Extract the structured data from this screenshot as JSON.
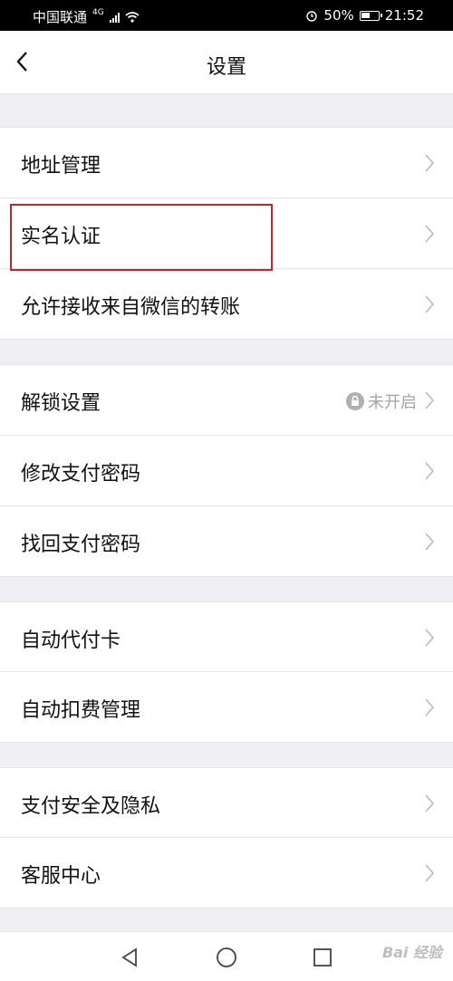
{
  "status_bar": {
    "carrier": "中国联通",
    "network": "4G",
    "battery": "50%",
    "time": "21:52"
  },
  "nav": {
    "title": "设置"
  },
  "sections": [
    {
      "items": [
        {
          "label": "地址管理"
        },
        {
          "label": "实名认证"
        },
        {
          "label": "允许接收来自微信的转账"
        }
      ]
    },
    {
      "items": [
        {
          "label": "解锁设置",
          "value": "未开启"
        },
        {
          "label": "修改支付密码"
        },
        {
          "label": "找回支付密码"
        }
      ]
    },
    {
      "items": [
        {
          "label": "自动代付卡"
        },
        {
          "label": "自动扣费管理"
        }
      ]
    },
    {
      "items": [
        {
          "label": "支付安全及隐私"
        },
        {
          "label": "客服中心"
        }
      ]
    }
  ],
  "watermark": "Bai 经验"
}
